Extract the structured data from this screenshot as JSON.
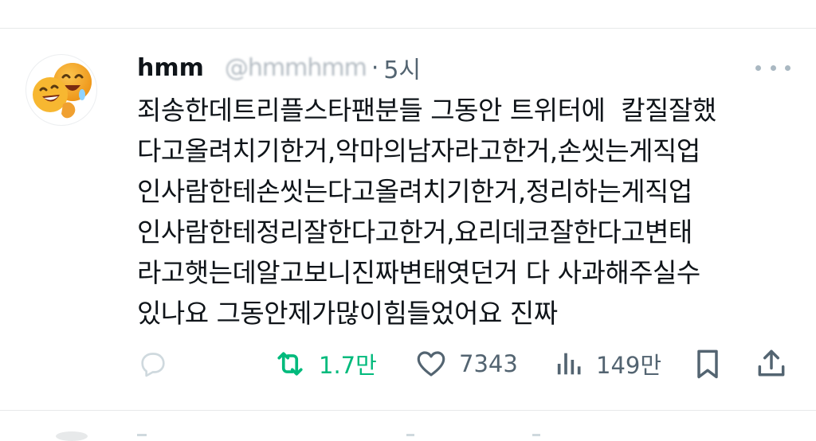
{
  "tweet": {
    "display_name": "hmm",
    "handle": "@hmmhmm",
    "time_separator": "·",
    "time": "5시",
    "body": "죄송한데트리플스타팬분들 그동안 트위터에  칼질잘했\n다고올려치기한거,악마의남자라고한거,손씻는게직업\n인사람한테손씻는다고올려치기한거,정리하는게직업\n인사람한테정리잘한다고한거,요리데코잘한다고변태\n라고햇는데알고보니진짜변태엿던거 다 사과해주실수\n있나요 그동안제가많이힘들었어요 진짜",
    "more_icon": "more-dots-icon"
  },
  "actions": {
    "reply": {
      "icon": "reply-icon",
      "count": ""
    },
    "retweet": {
      "icon": "retweet-icon",
      "count": "1.7만",
      "color": "#00ba7c"
    },
    "like": {
      "icon": "heart-icon",
      "count": "7343"
    },
    "views": {
      "icon": "views-icon",
      "count": "149만"
    },
    "bookmark": {
      "icon": "bookmark-icon"
    },
    "share": {
      "icon": "share-icon"
    }
  },
  "colors": {
    "text": "#0f1419",
    "secondary": "#536471",
    "retweet_green": "#00ba7c",
    "divider": "#e7e9ea"
  }
}
